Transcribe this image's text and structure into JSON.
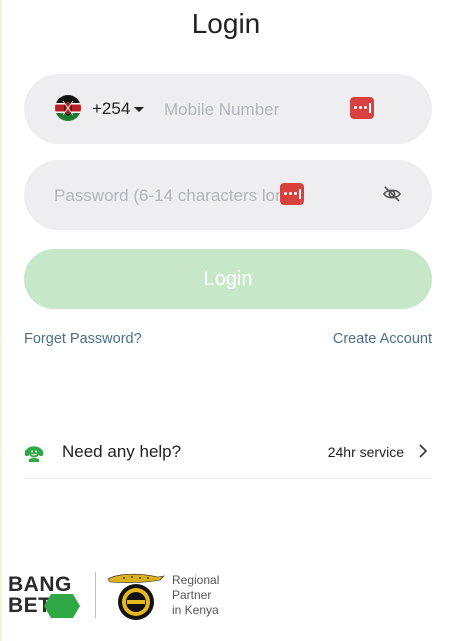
{
  "page": {
    "title": "Login"
  },
  "phone": {
    "country_code": "+254",
    "country_flag": "kenya-flag-icon",
    "placeholder": "Mobile Number"
  },
  "password": {
    "placeholder": "Password (6-14 characters long)"
  },
  "login_button": {
    "label": "Login",
    "color": "#c6e8c9"
  },
  "links": {
    "forget": "Forget Password?",
    "create": "Create Account"
  },
  "help": {
    "label": "Need any help?",
    "service": "24hr service",
    "icon": "support-agent-icon"
  },
  "footer": {
    "brand_line1": "BANG",
    "brand_line2": "BET",
    "partner_logo": "safari-rally-logo",
    "partner_line1": "Regional",
    "partner_line2": "Partner",
    "partner_line3": "in Kenya"
  },
  "colors": {
    "accent": "#2fa845",
    "link": "#4a6f8d",
    "field_background": "#eeeef0",
    "password_manager_badge": "#d9413f"
  }
}
